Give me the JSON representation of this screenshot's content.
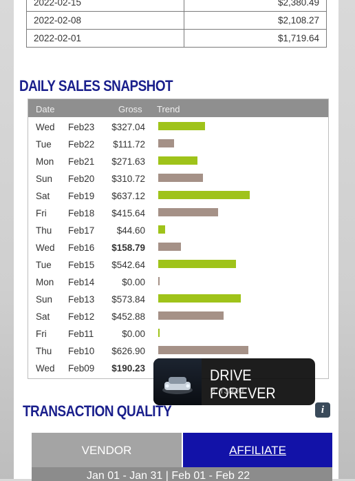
{
  "weekly_rows": [
    {
      "date": "2022-02-15",
      "gross": "$2,380.49"
    },
    {
      "date": "2022-02-08",
      "gross": "$2,108.27"
    },
    {
      "date": "2022-02-01",
      "gross": "$1,719.64"
    }
  ],
  "daily_section": {
    "title": "DAILY SALES SNAPSHOT",
    "headers": {
      "date": "Date",
      "gross": "Gross",
      "trend": "Trend"
    },
    "colors": {
      "up": "#9fc31a",
      "down": "#a59187"
    },
    "rows": [
      {
        "day": "Wed",
        "date": "Feb23",
        "gross": "$327.04",
        "value": 327.04,
        "trend": "up",
        "bold": false
      },
      {
        "day": "Tue",
        "date": "Feb22",
        "gross": "$111.72",
        "value": 111.72,
        "trend": "down",
        "bold": false
      },
      {
        "day": "Mon",
        "date": "Feb21",
        "gross": "$271.63",
        "value": 271.63,
        "trend": "up",
        "bold": false
      },
      {
        "day": "Sun",
        "date": "Feb20",
        "gross": "$310.72",
        "value": 310.72,
        "trend": "down",
        "bold": false
      },
      {
        "day": "Sat",
        "date": "Feb19",
        "gross": "$637.12",
        "value": 637.12,
        "trend": "up",
        "bold": false
      },
      {
        "day": "Fri",
        "date": "Feb18",
        "gross": "$415.64",
        "value": 415.64,
        "trend": "down",
        "bold": false
      },
      {
        "day": "Thu",
        "date": "Feb17",
        "gross": "$44.60",
        "value": 44.6,
        "trend": "up",
        "bold": false
      },
      {
        "day": "Wed",
        "date": "Feb16",
        "gross": "$158.79",
        "value": 158.79,
        "trend": "down",
        "bold": true
      },
      {
        "day": "Tue",
        "date": "Feb15",
        "gross": "$542.64",
        "value": 542.64,
        "trend": "up",
        "bold": false
      },
      {
        "day": "Mon",
        "date": "Feb14",
        "gross": "$0.00",
        "value": 0,
        "trend": "down",
        "bold": false
      },
      {
        "day": "Sun",
        "date": "Feb13",
        "gross": "$573.84",
        "value": 573.84,
        "trend": "up",
        "bold": false
      },
      {
        "day": "Sat",
        "date": "Feb12",
        "gross": "$452.88",
        "value": 452.88,
        "trend": "down",
        "bold": false
      },
      {
        "day": "Fri",
        "date": "Feb11",
        "gross": "$0.00",
        "value": 0,
        "trend": "up",
        "bold": false
      },
      {
        "day": "Thu",
        "date": "Feb10",
        "gross": "$626.90",
        "value": 626.9,
        "trend": "down",
        "bold": false
      },
      {
        "day": "Wed",
        "date": "Feb09",
        "gross": "$190.23",
        "value": 190.23,
        "trend": "up",
        "bold": true
      }
    ]
  },
  "quality_section": {
    "title": "TRANSACTION QUALITY",
    "info_icon": "info-icon",
    "tabs": {
      "vendor": "VENDOR",
      "affiliate": "AFFILIATE"
    },
    "date_range": "Jan 01 - Jan 31 | Feb 01 - Feb 22"
  },
  "overlay": {
    "title": "DRIVE FOREVER",
    "subtitle": "♬ T3NZU"
  }
}
